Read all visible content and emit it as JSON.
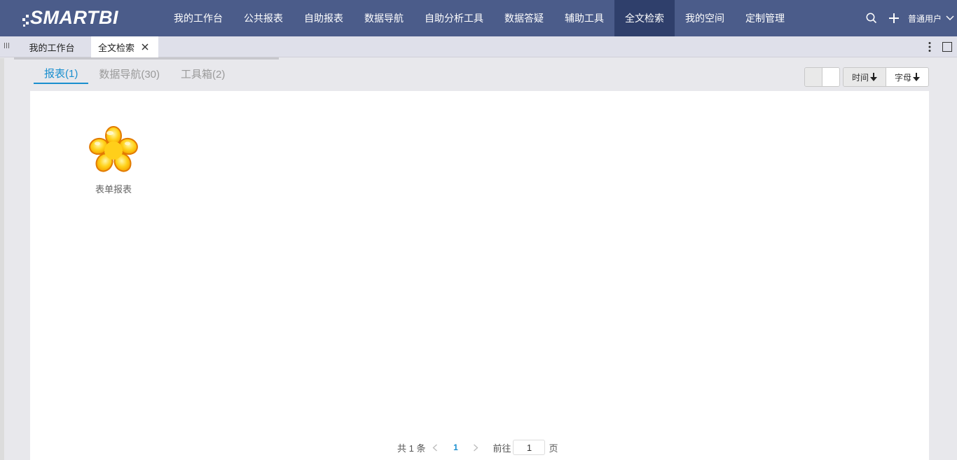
{
  "brand": {
    "logo_text": "SMARTBI"
  },
  "nav": {
    "items": [
      "我的工作台",
      "公共报表",
      "自助报表",
      "数据导航",
      "自助分析工具",
      "数据答疑",
      "辅助工具",
      "全文检索",
      "我的空间",
      "定制管理"
    ],
    "active": "全文检索",
    "search_icon": "search-icon",
    "add_icon": "plus-icon",
    "user": "普通用户"
  },
  "tabs": {
    "items": [
      {
        "label": "我的工作台"
      },
      {
        "label": "全文检索",
        "closable": true,
        "active": true
      }
    ]
  },
  "subtabs": {
    "items": [
      "报表(1)",
      "数据导航(30)",
      "工具箱(2)"
    ],
    "active_index": 0
  },
  "sort": {
    "time_label": "时间",
    "letter_label": "字母"
  },
  "results": [
    {
      "label": "表单报表",
      "icon": "flower-report-icon"
    }
  ],
  "pager": {
    "total_text": "共 1 条",
    "current_page": "1",
    "goto_label": "前往",
    "goto_value": "1",
    "page_suffix": "页"
  },
  "colors": {
    "nav_bg": "#4b5c8a",
    "nav_active_bg": "#2f3f6b",
    "accent": "#1a8fcf"
  }
}
